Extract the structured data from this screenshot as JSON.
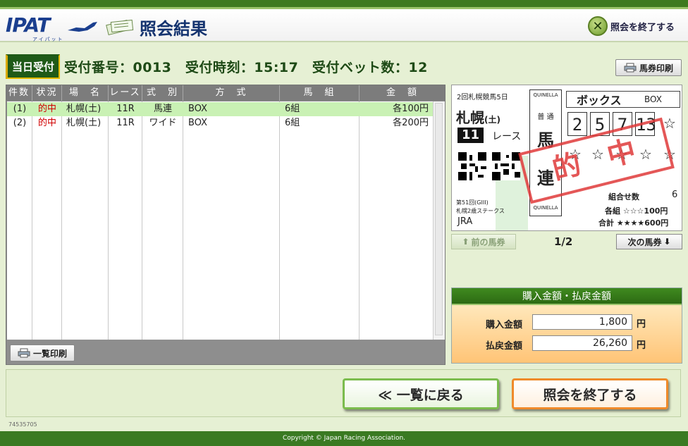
{
  "header": {
    "logo": "IPAT",
    "logo_sub": "アイパット",
    "title": "照会結果",
    "end_label": "照会を終了する"
  },
  "info": {
    "badge": "当日受付",
    "text": "受付番号：0013　受付時刻：15:17　受付ベット数：12"
  },
  "print_ticket_label": "馬券印刷",
  "print_list_label": "一覧印刷",
  "table": {
    "headers": [
      "件数",
      "状況",
      "場　名",
      "レース",
      "式　別",
      "方　式",
      "馬　組",
      "金　額"
    ],
    "rows": [
      [
        "(1)",
        "的中",
        "札幌(土)",
        "11R",
        "馬連",
        "BOX",
        "6組",
        "各100円"
      ],
      [
        "(2)",
        "的中",
        "札幌(土)",
        "11R",
        "ワイド",
        "BOX",
        "6組",
        "各200円"
      ]
    ]
  },
  "ticket": {
    "meeting": "2回札幌競馬5日",
    "place": "札幌",
    "day": "(土)",
    "race_no": "11",
    "race_label": "レース",
    "quinella": "QUINELLA",
    "futsu": "普 通",
    "bet_type_1": "馬",
    "bet_type_2": "連",
    "box_label": "ボックス",
    "box_en": "BOX",
    "horses": [
      "2",
      "5",
      "7",
      "13"
    ],
    "stamp": "的中",
    "combo_label": "組合せ数",
    "combo_value": "6",
    "each_text": "各組 ☆☆☆100円",
    "total_text": "合計 ★★★★600円",
    "race_name_1": "第51回(GIII)",
    "race_name_2": "札幌2歳ステークス",
    "jra": "JRA"
  },
  "pager": {
    "prev": "前の馬券",
    "page": "1/2",
    "next": "次の馬券"
  },
  "amount": {
    "title": "購入金額・払戻金額",
    "purchase_label": "購入金額",
    "purchase_value": "1,800",
    "payout_label": "払戻金額",
    "payout_value": "26,260",
    "yen": "円"
  },
  "buttons": {
    "back": "≪ 一覧に戻る",
    "end": "照会を終了する"
  },
  "build_id": "74535705",
  "footer": "Copyright © Japan Racing Association.",
  "colors": {
    "brand_green": "#3a7a22",
    "hit_red": "#d00000",
    "selected_row": "#c9f1b4"
  }
}
